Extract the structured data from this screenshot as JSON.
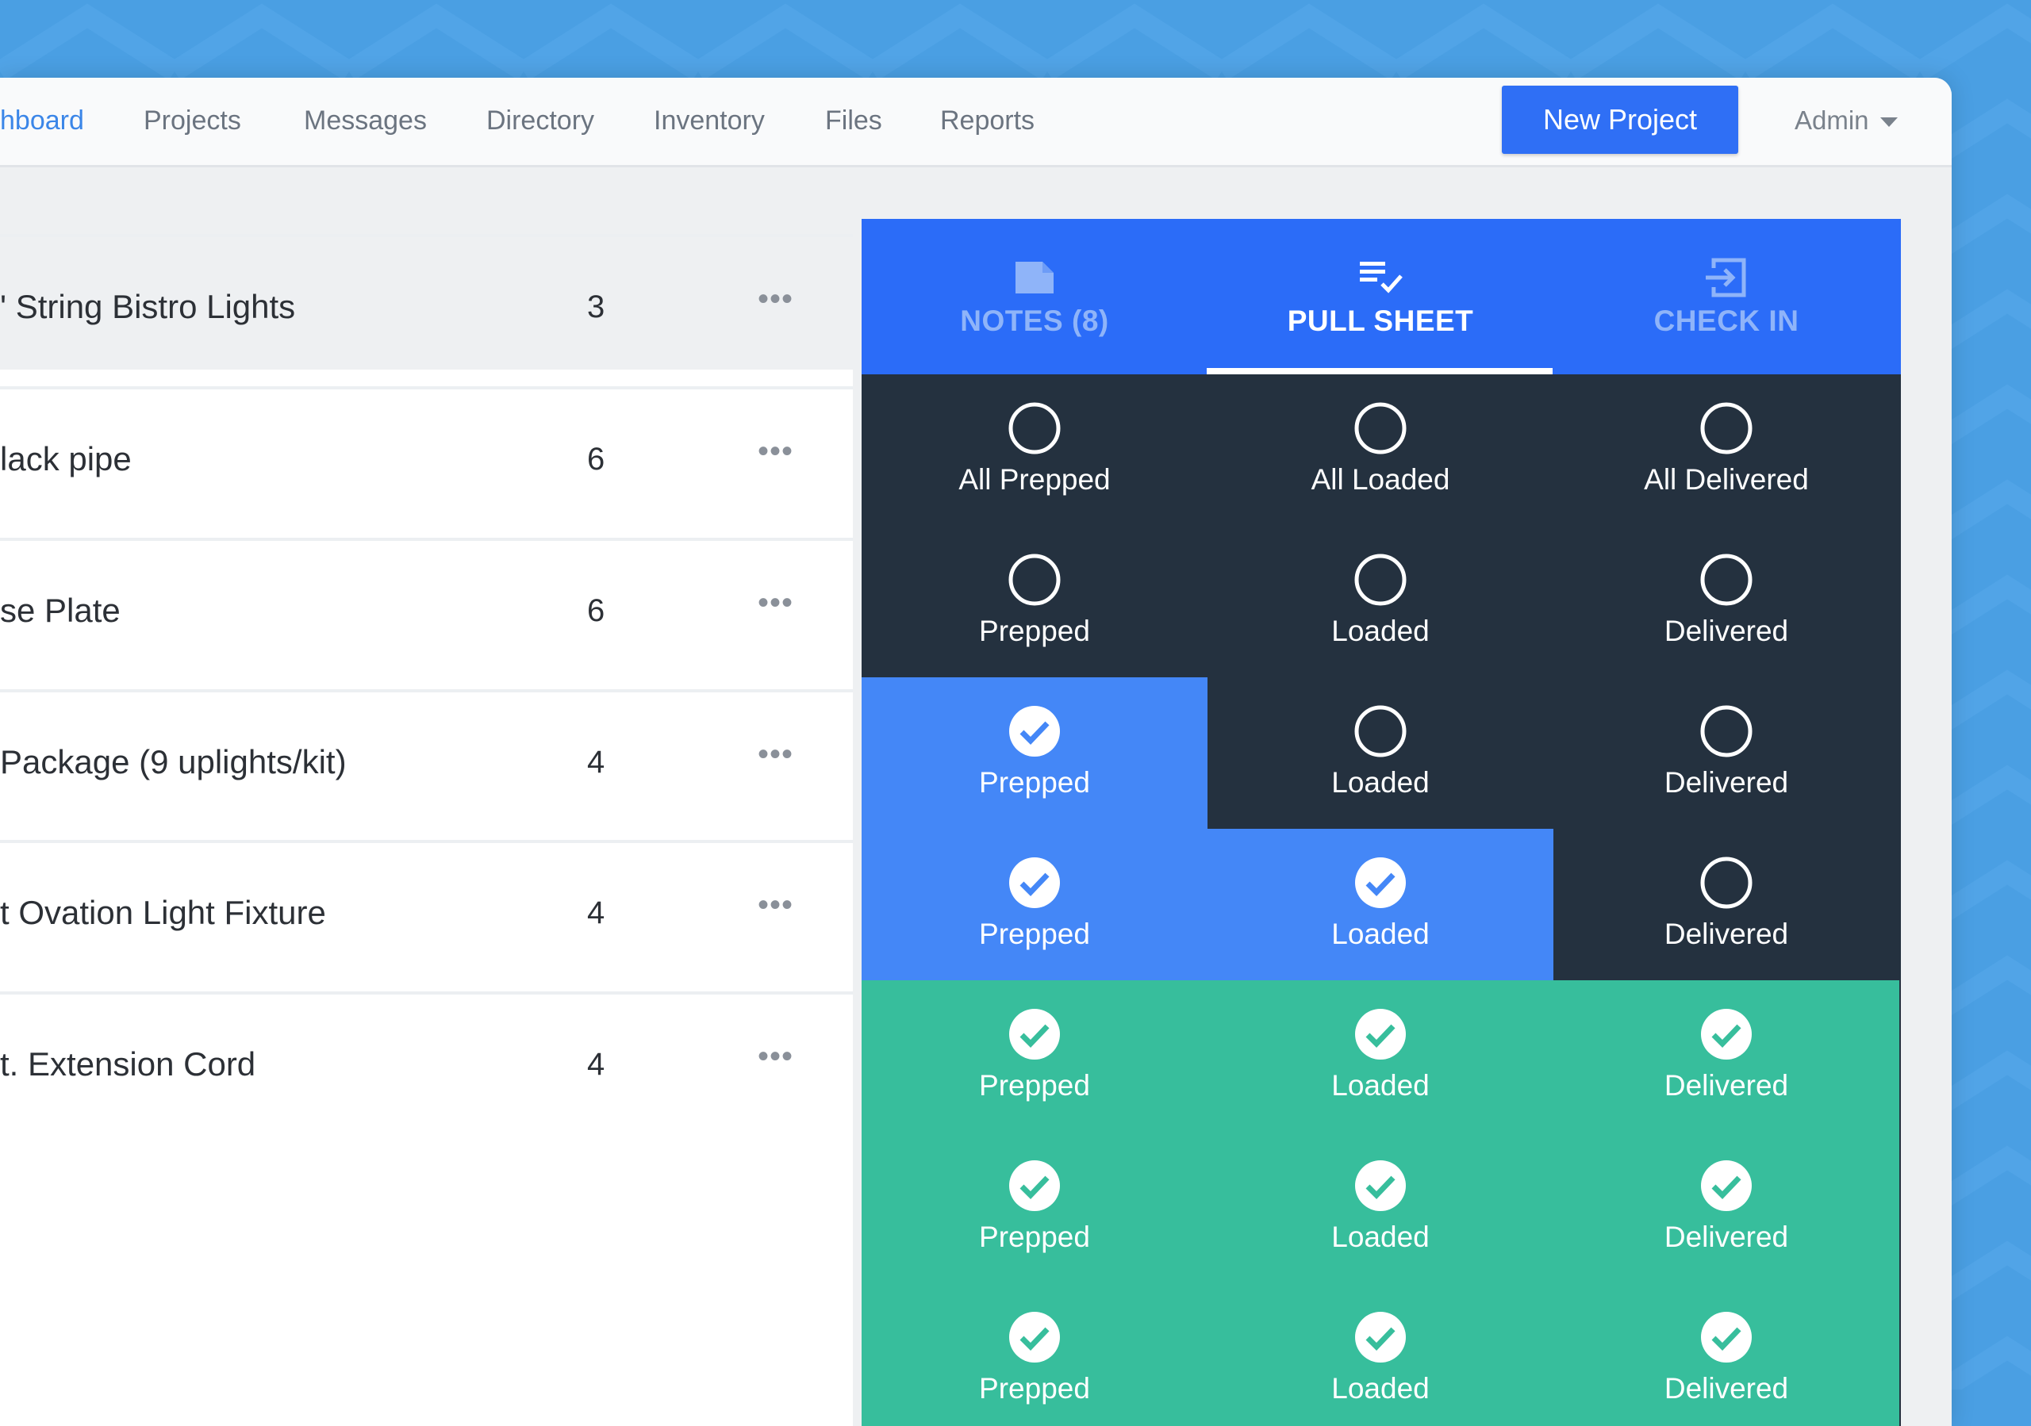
{
  "nav": {
    "items": [
      "hboard",
      "Projects",
      "Messages",
      "Directory",
      "Inventory",
      "Files",
      "Reports"
    ],
    "new_project": "New Project",
    "admin": "Admin",
    "accent": "#3b86e8"
  },
  "items": [
    {
      "name": "' String Bistro Lights",
      "qty": "3",
      "more": "•••"
    },
    {
      "name": "lack pipe",
      "qty": "6",
      "more": "•••"
    },
    {
      "name": "se Plate",
      "qty": "6",
      "more": "•••"
    },
    {
      "name": "Package (9 uplights/kit)",
      "qty": "4",
      "more": "•••"
    },
    {
      "name": "t Ovation Light Fixture",
      "qty": "4",
      "more": "•••"
    },
    {
      "name": "t. Extension Cord",
      "qty": "4",
      "more": "•••"
    }
  ],
  "panel": {
    "tabs": [
      {
        "label": "NOTES (8)",
        "icon": "notes-icon"
      },
      {
        "label": "PULL SHEET",
        "icon": "checklist-icon"
      },
      {
        "label": "CHECK IN",
        "icon": "check-in-icon"
      }
    ],
    "active_tab": 1,
    "colors": {
      "tab_bg": "#2b6cf8",
      "dark": "#24313f",
      "blue": "#4487f7",
      "green": "#37be9c"
    },
    "header_row": [
      "All Prepped",
      "All Loaded",
      "All Delivered"
    ],
    "rows": [
      {
        "prepped": false,
        "loaded": false,
        "delivered": false
      },
      {
        "prepped": true,
        "loaded": false,
        "delivered": false
      },
      {
        "prepped": true,
        "loaded": true,
        "delivered": false
      },
      {
        "prepped": true,
        "loaded": true,
        "delivered": true
      },
      {
        "prepped": true,
        "loaded": true,
        "delivered": true
      },
      {
        "prepped": true,
        "loaded": true,
        "delivered": true
      }
    ],
    "status_labels": [
      "Prepped",
      "Loaded",
      "Delivered"
    ]
  }
}
